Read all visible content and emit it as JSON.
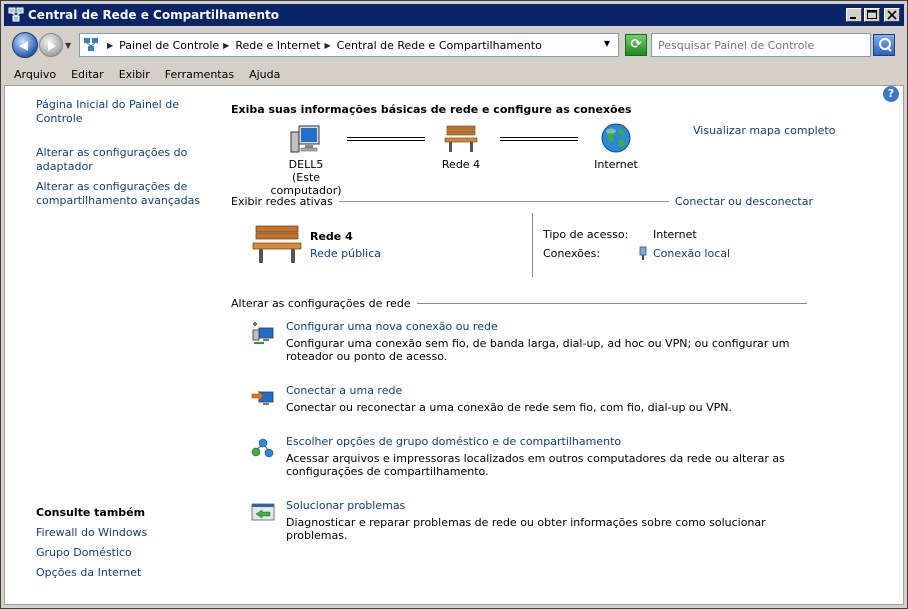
{
  "window": {
    "title": "Central de Rede e Compartilhamento"
  },
  "nav": {
    "breadcrumbs": [
      "Painel de Controle",
      "Rede e Internet",
      "Central de Rede e Compartilhamento"
    ],
    "search_placeholder": "Pesquisar Painel de Controle"
  },
  "menu": [
    "Arquivo",
    "Editar",
    "Exibir",
    "Ferramentas",
    "Ajuda"
  ],
  "sidebar": {
    "home": "Página Inicial do Painel de Controle",
    "adapter_1": "Alterar as configurações do",
    "adapter_2": "adaptador",
    "sharing_1": "Alterar as configurações de",
    "sharing_2": "compartilhamento avançadas",
    "see_also_title": "Consulte também",
    "see_also": [
      "Firewall do Windows",
      "Grupo Doméstico",
      "Opções da Internet"
    ]
  },
  "main": {
    "title": "Exiba suas informações básicas de rede e configure as conexões",
    "map_link": "Visualizar mapa completo",
    "map": {
      "computer_name": "DELL5",
      "computer_sub": "(Este computador)",
      "network": "Rede  4",
      "internet": "Internet"
    },
    "active_header": "Exibir redes ativas",
    "connect_link": "Conectar ou desconectar",
    "active_net": {
      "name": "Rede  4",
      "type": "Rede pública",
      "access_label": "Tipo de acesso:",
      "access_value": "Internet",
      "conn_label": "Conexões:",
      "conn_value": "Conexão local"
    },
    "change_header": "Alterar as configurações de rede",
    "tasks": [
      {
        "title": "Configurar uma nova conexão ou rede",
        "desc": "Configurar uma conexão sem fio, de banda larga, dial-up, ad hoc ou VPN; ou configurar um roteador ou ponto de acesso.",
        "icon": "new-connection-icon"
      },
      {
        "title": "Conectar a uma rede",
        "desc": "Conectar ou reconectar a uma conexão de rede sem fio, com fio, dial-up ou VPN.",
        "icon": "connect-network-icon"
      },
      {
        "title": "Escolher opções de grupo doméstico e de compartilhamento",
        "desc": "Acessar arquivos e impressoras localizados em outros computadores da rede ou alterar as configurações de compartilhamento.",
        "icon": "homegroup-icon"
      },
      {
        "title": "Solucionar problemas",
        "desc": "Diagnosticar e reparar problemas de rede ou obter informações sobre como solucionar problemas.",
        "icon": "troubleshoot-icon"
      }
    ]
  },
  "colors": {
    "titlebar": "#0a246a",
    "link": "#0b3d91",
    "chrome": "#d4d0c8"
  }
}
